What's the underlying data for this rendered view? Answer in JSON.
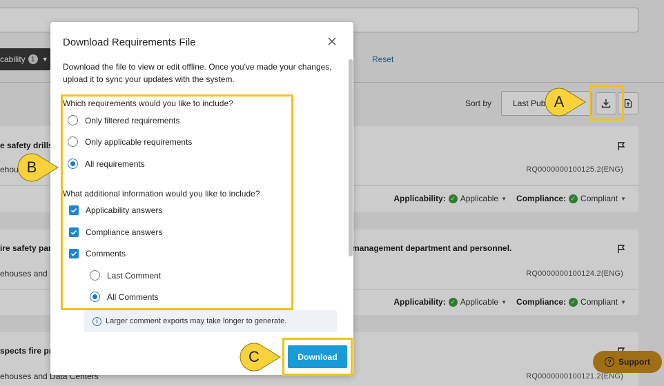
{
  "background": {
    "filter_chip": {
      "label": "cability",
      "count": "1"
    },
    "reset_link": "Reset",
    "sort": {
      "label": "Sort by",
      "value": "Last Pub"
    },
    "cards": [
      {
        "title": "e safety drills a",
        "subtitle": "ehou",
        "id": "RQ0000000100125.2(ENG)",
        "applicability_label": "Applicability:",
        "applicability_value": "Applicable",
        "compliance_label": "Compliance:",
        "compliance_value": "Compliant"
      },
      {
        "title": "ire safety part",
        "title_right": "management department and personnel.",
        "subtitle": "ehouses and D",
        "id": "RQ0000000100124.2(ENG)",
        "applicability_label": "Applicability:",
        "applicability_value": "Applicable",
        "compliance_label": "Compliance:",
        "compliance_value": "Compliant"
      },
      {
        "title": "spects fire pre",
        "subtitle": "ehouses and Data Centers",
        "id": "RQ0000000100121.2(ENG)"
      }
    ],
    "support_label": "Support"
  },
  "callouts": {
    "a": "A",
    "b": "B",
    "c": "C"
  },
  "modal": {
    "title": "Download Requirements File",
    "description": "Download the file to view or edit offline. Once you've made your changes, upload it to sync your updates with the system.",
    "q1": "Which requirements would you like to include?",
    "q1_options": [
      "Only filtered requirements",
      "Only applicable requirements",
      "All requirements"
    ],
    "q1_selected": "All requirements",
    "q2": "What additional information would you like to include?",
    "q2_options": [
      "Applicability answers",
      "Compliance answers",
      "Comments"
    ],
    "comment_options": [
      "Last Comment",
      "All Comments"
    ],
    "comment_selected": "All Comments",
    "info_note": "Larger comment exports may take longer to generate.",
    "download_label": "Download"
  },
  "colors": {
    "primary": "#1a9bd8",
    "checkbox": "#1a87d0",
    "highlight": "#f2c318",
    "callout_fill": "#f7d23b",
    "success": "#3d9a3d",
    "support": "#c98a1a"
  }
}
